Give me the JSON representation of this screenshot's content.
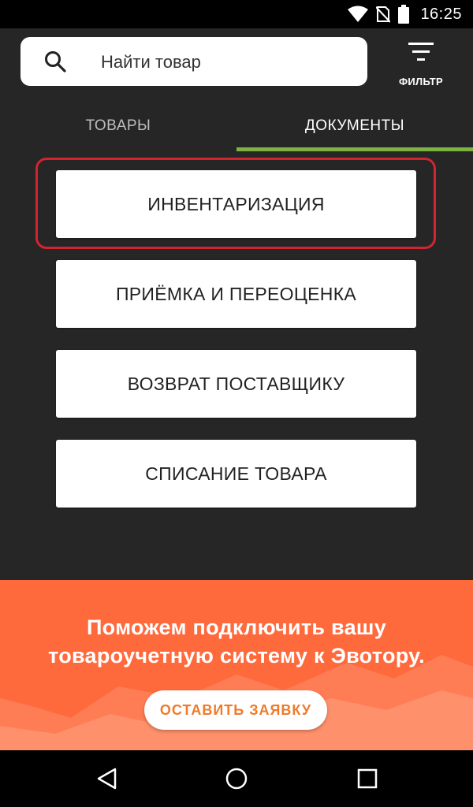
{
  "status_bar": {
    "time": "16:25",
    "icons": [
      "wifi-icon",
      "no-sim-icon",
      "battery-icon"
    ]
  },
  "search": {
    "placeholder": "Найти товар",
    "icon": "search-icon"
  },
  "filter": {
    "label": "ФИЛЬТР",
    "icon": "filter-icon"
  },
  "tabs": [
    {
      "label": "ТОВАРЫ",
      "active": false
    },
    {
      "label": "ДОКУМЕНТЫ",
      "active": true
    }
  ],
  "documents": [
    {
      "label": "ИНВЕНТАРИЗАЦИЯ",
      "highlighted": true
    },
    {
      "label": "ПРИЁМКА И ПЕРЕОЦЕНКА",
      "highlighted": false
    },
    {
      "label": "ВОЗВРАТ ПОСТАВЩИКУ",
      "highlighted": false
    },
    {
      "label": "СПИСАНИЕ ТОВАРА",
      "highlighted": false
    }
  ],
  "promo": {
    "line1": "Поможем подключить вашу",
    "line2": "товароучетную систему к Эвотору.",
    "cta": "ОСТАВИТЬ ЗАЯВКУ"
  },
  "nav": [
    "back-icon",
    "home-icon",
    "recents-icon"
  ],
  "colors": {
    "background": "#262626",
    "tab_indicator": "#7cb342",
    "highlight": "#d3242f",
    "promo_bg": "#ff6a3d",
    "cta_text": "#f07a2a"
  }
}
